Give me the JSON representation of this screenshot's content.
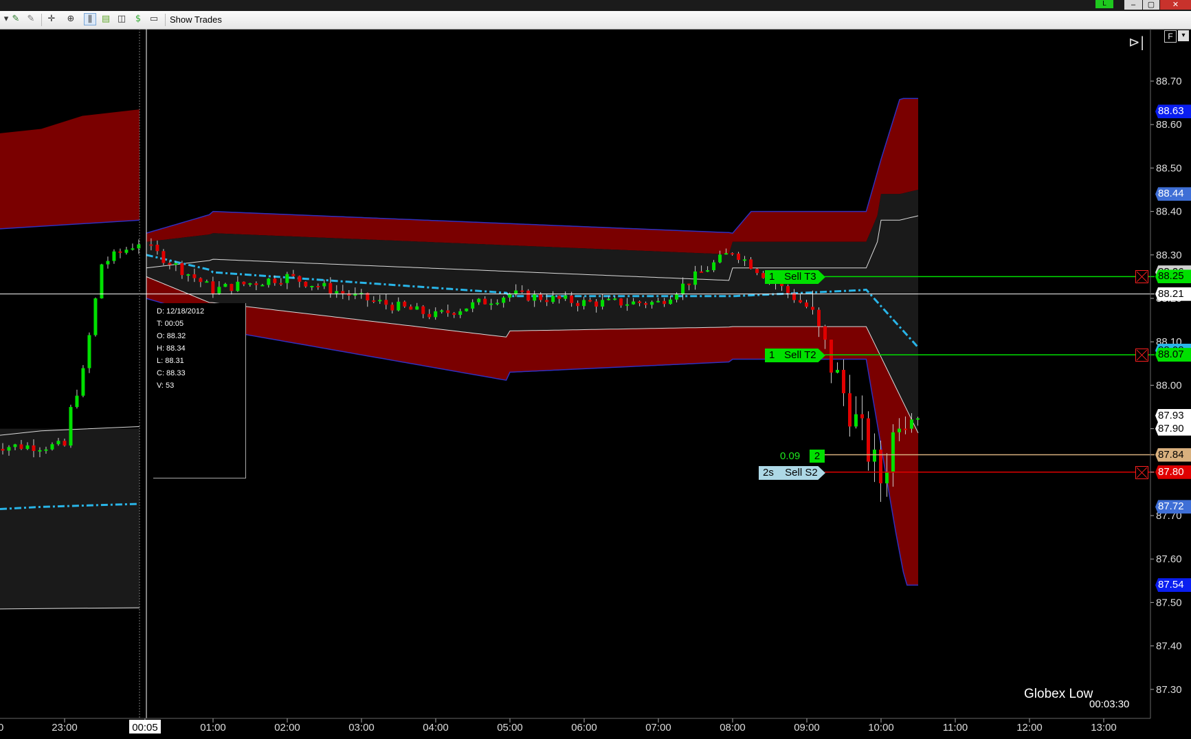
{
  "toolbar": {
    "show_trades_label": "Show Trades",
    "icons": [
      "dropdown-arrow-icon",
      "draw-tool-icon",
      "draw-tool-alt-icon",
      "crosshair-icon",
      "zoom-icon",
      "bar-type-icon",
      "indicators-icon",
      "chart-style-icon",
      "strategy-icon",
      "properties-icon"
    ]
  },
  "window": {
    "status_badge": "L",
    "controls": [
      "–",
      "▢",
      "✕"
    ]
  },
  "chart_data": {
    "type": "candlestick",
    "instrument_session_note": "Globex Low",
    "bar_timer": "00:03:30",
    "cursor_time_label": "00:05",
    "cursor_price_label": "88.21",
    "x_tick_labels": [
      "23:00",
      "00:05",
      "01:00",
      "02:00",
      "03:00",
      "04:00",
      "05:00",
      "06:00",
      "07:00",
      "08:00",
      "09:00",
      "10:00",
      "11:00",
      "12:00",
      "13:00"
    ],
    "x_tick_hours": [
      23,
      24.083,
      25,
      26,
      27,
      28,
      29,
      30,
      31,
      32,
      33,
      34,
      35,
      36,
      37
    ],
    "x_left_partial_label": "0",
    "y_range": [
      87.23,
      88.8
    ],
    "y_tick_labels": [
      "88.70",
      "88.60",
      "88.50",
      "88.40",
      "88.30",
      "88.20",
      "88.10",
      "88.00",
      "87.90",
      "87.80",
      "87.70",
      "87.60",
      "87.50",
      "87.40",
      "87.30"
    ],
    "y_ticks": [
      88.7,
      88.6,
      88.5,
      88.4,
      88.3,
      88.2,
      88.1,
      88.0,
      87.9,
      87.8,
      87.7,
      87.6,
      87.5,
      87.4,
      87.3
    ],
    "data_box": {
      "date": "D: 12/18/2012",
      "time": "T: 00:05",
      "open": "O: 88.32",
      "high": "H: 88.34",
      "low": "L: 88.31",
      "close": "C: 88.33",
      "volume": "V: 53"
    },
    "price_markers": [
      {
        "value": "88.63",
        "bg": "#0a1ef0",
        "fg": "#ffffff"
      },
      {
        "value": "88.44",
        "bg": "#3f6fd6",
        "fg": "#ffffff"
      },
      {
        "value": "88.26",
        "bg": "#d0d0d0",
        "fg": "#000000"
      },
      {
        "value": "88.25",
        "bg": "#00e000",
        "fg": "#000000"
      },
      {
        "value": "88.21",
        "bg": "#ffffff",
        "fg": "#000000"
      },
      {
        "value": "88.08",
        "bg": "#29b5e8",
        "fg": "#000000"
      },
      {
        "value": "88.07",
        "bg": "#00e000",
        "fg": "#000000"
      },
      {
        "value": "87.93",
        "bg": "#ffffff",
        "fg": "#000000"
      },
      {
        "value": "87.90",
        "bg": "#ffffff",
        "fg": "#000000"
      },
      {
        "value": "87.84",
        "bg": "#d9b07e",
        "fg": "#000000"
      },
      {
        "value": "87.80",
        "bg": "#e00000",
        "fg": "#ffffff"
      },
      {
        "value": "87.72",
        "bg": "#3f6fd6",
        "fg": "#ffffff"
      },
      {
        "value": "87.54",
        "bg": "#0a1ef0",
        "fg": "#ffffff"
      }
    ],
    "orders": [
      {
        "qty": "1",
        "label": "Sell T3",
        "price": 88.25,
        "color": "#00e000"
      },
      {
        "qty": "1",
        "label": "Sell T2",
        "price": 88.07,
        "color": "#00e000"
      },
      {
        "qty": "2s",
        "label": "Sell S2",
        "price": 87.8,
        "color": "#e00000",
        "tag_bg": "#add8e6"
      }
    ],
    "position": {
      "pnl": "0.09",
      "qty": "2",
      "avg_price": 87.84
    },
    "candles_sampled": [
      {
        "t": 23.0,
        "o": 87.88,
        "h": 87.92,
        "l": 87.84,
        "c": 87.9
      },
      {
        "t": 23.25,
        "o": 88.0,
        "h": 88.05,
        "l": 87.97,
        "c": 88.03
      },
      {
        "t": 23.5,
        "o": 88.2,
        "h": 88.38,
        "l": 88.12,
        "c": 88.28
      },
      {
        "t": 24.0,
        "o": 88.32,
        "h": 88.37,
        "l": 88.28,
        "c": 88.33
      },
      {
        "t": 25.0,
        "o": 88.26,
        "h": 88.28,
        "l": 88.2,
        "c": 88.22
      },
      {
        "t": 26.0,
        "o": 88.27,
        "h": 88.29,
        "l": 88.22,
        "c": 88.25
      },
      {
        "t": 27.0,
        "o": 88.22,
        "h": 88.24,
        "l": 88.18,
        "c": 88.2
      },
      {
        "t": 28.0,
        "o": 88.18,
        "h": 88.2,
        "l": 88.13,
        "c": 88.16
      },
      {
        "t": 29.0,
        "o": 88.15,
        "h": 88.23,
        "l": 88.12,
        "c": 88.21
      },
      {
        "t": 30.0,
        "o": 88.2,
        "h": 88.22,
        "l": 88.17,
        "c": 88.19
      },
      {
        "t": 31.0,
        "o": 88.18,
        "h": 88.2,
        "l": 88.15,
        "c": 88.19
      },
      {
        "t": 32.0,
        "o": 88.22,
        "h": 88.38,
        "l": 88.18,
        "c": 88.31
      },
      {
        "t": 33.0,
        "o": 88.2,
        "h": 88.32,
        "l": 88.1,
        "c": 88.18
      },
      {
        "t": 34.0,
        "o": 87.9,
        "h": 87.95,
        "l": 87.68,
        "c": 87.78
      },
      {
        "t": 34.25,
        "o": 87.78,
        "h": 88.0,
        "l": 87.76,
        "c": 87.94
      },
      {
        "t": 34.5,
        "o": 87.95,
        "h": 88.0,
        "l": 87.9,
        "c": 87.93
      }
    ]
  }
}
